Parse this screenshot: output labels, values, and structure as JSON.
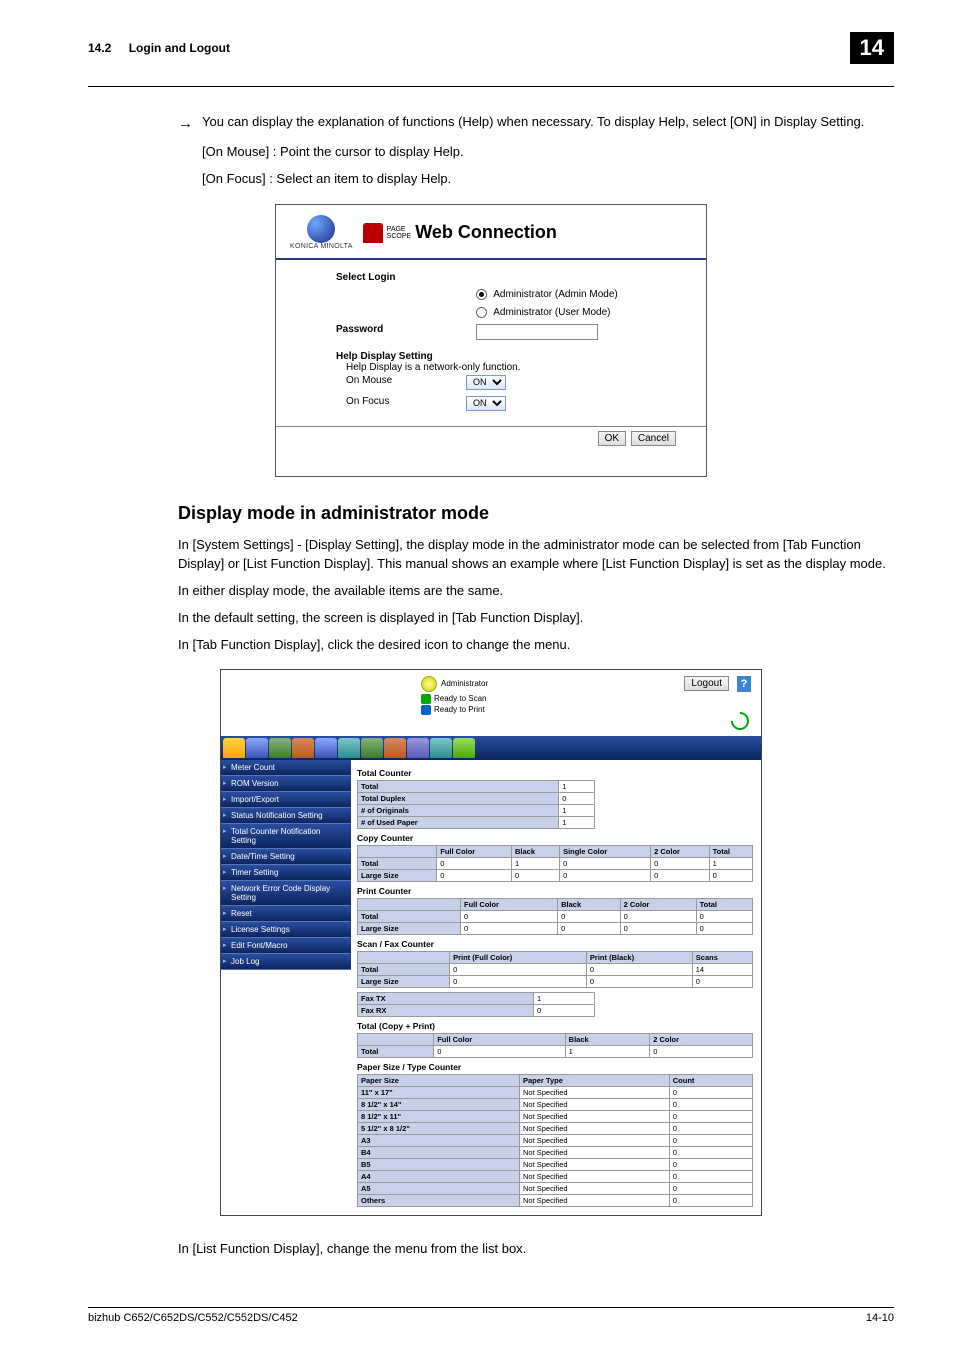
{
  "header": {
    "section_number": "14.2",
    "section_title": "Login and Logout",
    "chapter_number": "14"
  },
  "body": {
    "arrow_line": "You can display the explanation of functions (Help) when necessary. To display Help, select [ON] in Display Setting.",
    "help_line_1": "[On Mouse] : Point the cursor to display Help.",
    "help_line_2": "[On Focus] : Select an item to display Help.",
    "subheading": "Display mode in administrator mode",
    "para1": "In [System Settings] - [Display Setting], the display mode in the administrator mode can be selected from [Tab Function Display] or [List Function Display]. This manual shows an example where [List Function Display] is set as the display mode.",
    "para2": "In either display mode, the available items are the same.",
    "para3": "In the default setting, the screen is displayed in [Tab Function Display].",
    "para4": "In [Tab Function Display], click the desired icon to change the menu.",
    "para5": "In [List Function Display], change the menu from the list box."
  },
  "login_shot": {
    "brand_small": "KONICA MINOLTA",
    "ps_small_1": "PAGE",
    "ps_small_2": "SCOPE",
    "ps_big": "Web Connection",
    "select_login_label": "Select Login",
    "radio1": "Administrator (Admin Mode)",
    "radio2": "Administrator (User Mode)",
    "password_label": "Password",
    "help_heading": "Help Display Setting",
    "help_sub": "Help Display is a network-only function.",
    "on_mouse_label": "On Mouse",
    "on_focus_label": "On Focus",
    "on_value": "ON",
    "ok": "OK",
    "cancel": "Cancel"
  },
  "admin_shot": {
    "administrator": "Administrator",
    "logout": "Logout",
    "ready_scan": "Ready to Scan",
    "ready_print": "Ready to Print",
    "sidebar": [
      "Meter Count",
      "ROM Version",
      "Import/Export",
      "Status Notification Setting",
      "Total Counter Notification Setting",
      "Date/Time Setting",
      "Timer Setting",
      "Network Error Code Display Setting",
      "Reset",
      "License Settings",
      "Edit Font/Macro",
      "Job Log"
    ],
    "sect_total_counter": "Total Counter",
    "total_counter_rows": [
      [
        "Total",
        "1"
      ],
      [
        "Total Duplex",
        "0"
      ],
      [
        "# of Originals",
        "1"
      ],
      [
        "# of Used Paper",
        "1"
      ]
    ],
    "sect_copy_counter": "Copy Counter",
    "copy_head": [
      "",
      "Full Color",
      "Black",
      "Single Color",
      "2 Color",
      "Total"
    ],
    "copy_rows": [
      [
        "Total",
        "0",
        "1",
        "0",
        "0",
        "1"
      ],
      [
        "Large Size",
        "0",
        "0",
        "0",
        "0",
        "0"
      ]
    ],
    "sect_print_counter": "Print Counter",
    "print_head": [
      "",
      "Full Color",
      "Black",
      "2 Color",
      "Total"
    ],
    "print_rows": [
      [
        "Total",
        "0",
        "0",
        "0",
        "0"
      ],
      [
        "Large Size",
        "0",
        "0",
        "0",
        "0"
      ]
    ],
    "sect_scanfax": "Scan / Fax Counter",
    "scanfax_head": [
      "",
      "Print (Full Color)",
      "Print (Black)",
      "Scans"
    ],
    "scanfax_rows": [
      [
        "Total",
        "0",
        "0",
        "14"
      ],
      [
        "Large Size",
        "0",
        "0",
        "0"
      ]
    ],
    "fax_tx_label": "Fax TX",
    "fax_tx_val": "1",
    "fax_rx_label": "Fax RX",
    "fax_rx_val": "0",
    "sect_total_cp": "Total (Copy + Print)",
    "total_cp_head": [
      "",
      "Full Color",
      "Black",
      "2 Color"
    ],
    "total_cp_rows": [
      [
        "Total",
        "0",
        "1",
        "0"
      ]
    ],
    "sect_paper": "Paper Size / Type Counter",
    "paper_head": [
      "Paper Size",
      "Paper Type",
      "Count"
    ],
    "paper_rows": [
      [
        "11\" x 17\"",
        "Not Specified",
        "0"
      ],
      [
        "8 1/2\" x 14\"",
        "Not Specified",
        "0"
      ],
      [
        "8 1/2\" x 11\"",
        "Not Specified",
        "0"
      ],
      [
        "5 1/2\" x 8 1/2\"",
        "Not Specified",
        "0"
      ],
      [
        "A3",
        "Not Specified",
        "0"
      ],
      [
        "B4",
        "Not Specified",
        "0"
      ],
      [
        "B5",
        "Not Specified",
        "0"
      ],
      [
        "A4",
        "Not Specified",
        "0"
      ],
      [
        "A5",
        "Not Specified",
        "0"
      ],
      [
        "Others",
        "Not Specified",
        "0"
      ]
    ]
  },
  "footer": {
    "model": "bizhub C652/C652DS/C552/C552DS/C452",
    "page": "14-10"
  }
}
